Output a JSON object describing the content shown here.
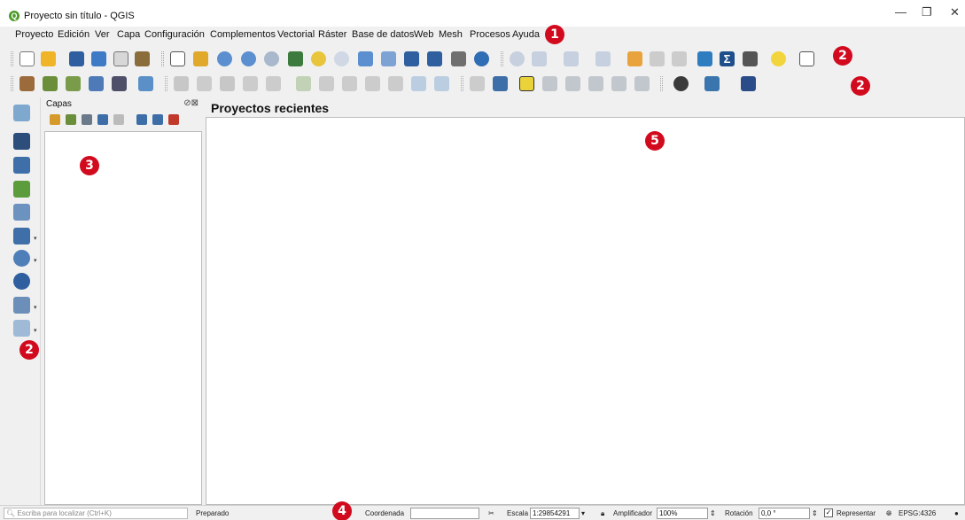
{
  "window": {
    "title": "Proyecto sin título - QGIS",
    "app_icon": "qgis-logo-icon",
    "minimize": "—",
    "restore": "❐",
    "close": "✕"
  },
  "menu": [
    "Proyecto",
    "Edición",
    "Ver",
    "Capa",
    "Configuración",
    "Complementos",
    "Vectorial",
    "Ráster",
    "Base de datos",
    "Web",
    "Mesh",
    "Procesos",
    "Ayuda"
  ],
  "badges": {
    "b1": "1",
    "b2": "2",
    "b3": "3",
    "b4": "4",
    "b5": "5",
    "color": "#d20a1e"
  },
  "layers_panel": {
    "title": "Capas",
    "header_buttons": "⊘⊠"
  },
  "recent": {
    "title": "Proyectos recientes"
  },
  "status": {
    "search_placeholder": "Escriba para localizar (Ctrl+K)",
    "message": "Preparado",
    "coord_label": "Coordenada",
    "coord_value": "",
    "scale_label": "Escala",
    "scale_value": "1:29854291",
    "magnifier_label": "Amplificador",
    "magnifier_value": "100%",
    "rotation_label": "Rotación",
    "rotation_value": "0,0 °",
    "render_label": "Representar",
    "crs": "EPSG:4326"
  },
  "icons": {
    "toolbar1": [
      "new-project-icon",
      "open-project-icon",
      "save-project-icon",
      "save-as-icon",
      "print-layout-icon",
      "style-manager-icon",
      "pan-icon",
      "pan-to-selection-icon",
      "zoom-in-icon",
      "zoom-out-icon",
      "zoom-native-icon",
      "zoom-full-icon",
      "zoom-selection-icon",
      "zoom-layer-icon",
      "zoom-last-icon",
      "zoom-next-icon",
      "new-bookmark-icon",
      "show-bookmarks-icon",
      "temporal-icon",
      "refresh-icon",
      "identify-icon",
      "select-icon",
      "attribute-table-icon",
      "field-calculator-icon",
      "toolbox-icon",
      "statistics-icon",
      "measure-icon",
      "annotation-icon",
      "text-annotation-icon"
    ],
    "toolbar2": [
      "data-source-manager-icon",
      "new-geopackage-icon",
      "new-shapefile-icon",
      "new-spatialite-icon",
      "new-memory-layer-icon",
      "new-virtual-layer-icon",
      "current-edits-icon",
      "toggle-editing-icon",
      "save-edits-icon",
      "add-point-icon",
      "vertex-tool-icon",
      "modify-attributes-icon",
      "delete-selected-icon",
      "cut-features-icon",
      "copy-features-icon",
      "paste-features-icon",
      "undo-icon",
      "redo-icon",
      "label-toolbar-icon",
      "pin-labels-icon",
      "highlight-labels-icon",
      "show-labels-icon",
      "move-label-icon",
      "rotate-label-icon",
      "change-label-icon",
      "label-props-icon",
      "diagram-icon",
      "python-console-icon",
      "help-icon"
    ],
    "left": [
      "add-vector-layer-icon",
      "add-raster-layer-icon",
      "add-mesh-layer-icon",
      "add-delimited-text-icon",
      "add-geopackage-icon",
      "add-spatialite-icon",
      "add-wms-layer-icon",
      "add-wfs-layer-icon",
      "add-xyz-layer-icon",
      "add-wcs-layer-icon",
      "add-virtual-layer-icon"
    ],
    "layers_panel": [
      "open-styling-icon",
      "add-group-icon",
      "manage-visibility-icon",
      "filter-legend-icon",
      "filter-expression-icon",
      "expand-all-icon",
      "collapse-all-icon",
      "remove-layer-icon"
    ],
    "status": [
      "search-icon",
      "mouse-coord-icon",
      "lock-scale-icon",
      "crs-icon",
      "messages-icon"
    ]
  }
}
